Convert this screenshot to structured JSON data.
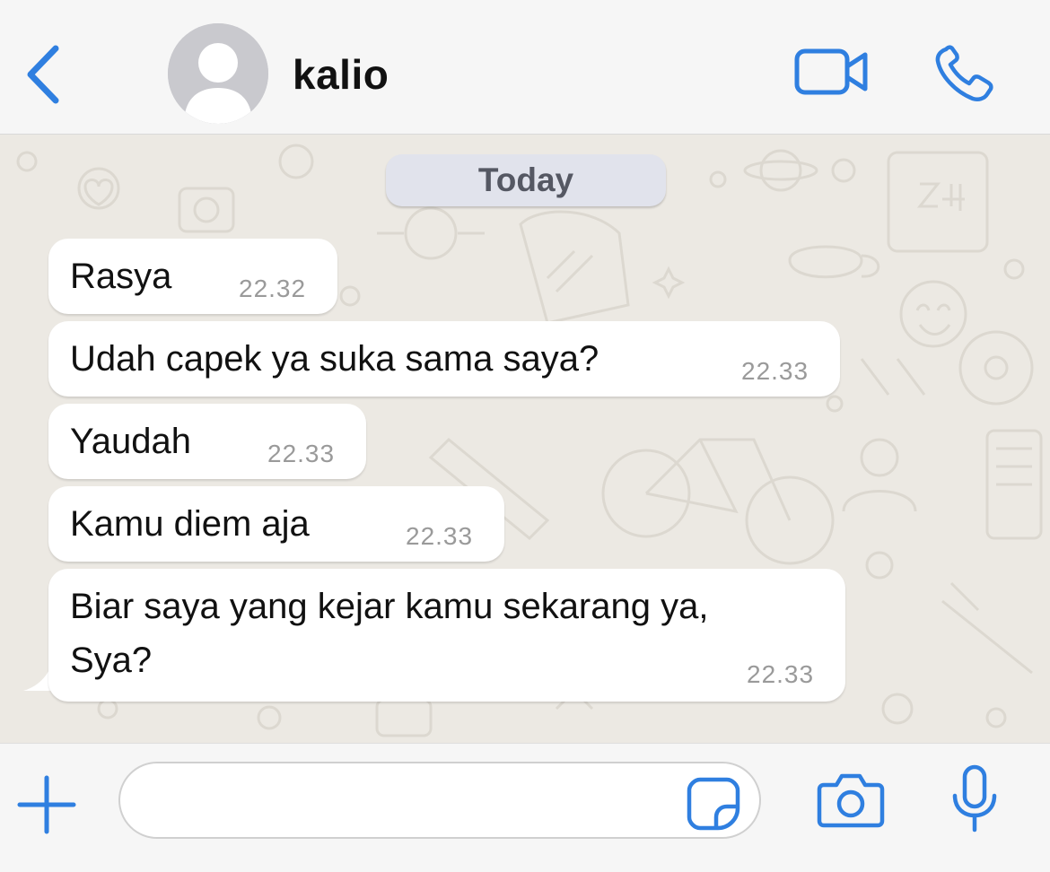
{
  "header": {
    "contact_name": "kalio"
  },
  "chat": {
    "date_label": "Today",
    "messages": [
      {
        "text": "Rasya",
        "time": "22.32"
      },
      {
        "text": "Udah capek ya suka sama saya?",
        "time": "22.33"
      },
      {
        "text": "Yaudah",
        "time": "22.33"
      },
      {
        "text": "Kamu diem aja",
        "time": "22.33"
      },
      {
        "text": "Biar saya yang kejar kamu sekarang ya,\nSya?",
        "time": "22.33"
      }
    ]
  },
  "input": {
    "value": ""
  },
  "colors": {
    "accent": "#2f7fe0",
    "wallpaper": "#ece9e3",
    "bubble": "#ffffff",
    "timestamp": "#9a9a9a",
    "date_pill": "#e1e3ec"
  },
  "icons": [
    "chevron-left-icon",
    "avatar-placeholder-icon",
    "video-camera-icon",
    "phone-icon",
    "plus-icon",
    "sticker-icon",
    "camera-icon",
    "microphone-icon"
  ]
}
